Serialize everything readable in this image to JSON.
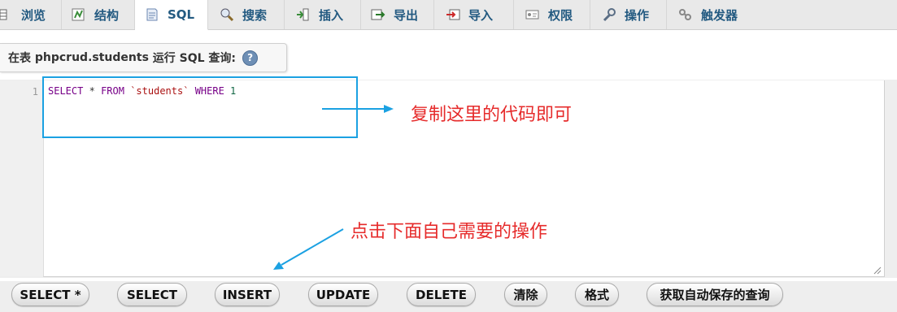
{
  "tabs": [
    {
      "label": "浏览",
      "icon": "browse-icon"
    },
    {
      "label": "结构",
      "icon": "structure-icon"
    },
    {
      "label": "SQL",
      "icon": "sql-icon",
      "active": true
    },
    {
      "label": "搜索",
      "icon": "search-icon"
    },
    {
      "label": "插入",
      "icon": "insert-icon"
    },
    {
      "label": "导出",
      "icon": "export-icon"
    },
    {
      "label": "导入",
      "icon": "import-icon"
    },
    {
      "label": "权限",
      "icon": "privileges-icon"
    },
    {
      "label": "操作",
      "icon": "operations-icon"
    },
    {
      "label": "触发器",
      "icon": "triggers-icon"
    }
  ],
  "query_panel": {
    "title_prefix": "在表 ",
    "table": "phpcrud.students",
    "title_suffix": " 运行 SQL 查询:"
  },
  "editor": {
    "line_number": "1",
    "tokens": {
      "select": "SELECT",
      "star": "*",
      "from": "FROM",
      "table": "`students`",
      "where": "WHERE",
      "value": "1"
    }
  },
  "annotations": {
    "copy_hint": "复制这里的代码即可",
    "click_hint": "点击下面自己需要的操作"
  },
  "buttons": [
    {
      "label": "SELECT *"
    },
    {
      "label": "SELECT"
    },
    {
      "label": "INSERT"
    },
    {
      "label": "UPDATE"
    },
    {
      "label": "DELETE"
    },
    {
      "label": "清除"
    },
    {
      "label": "格式"
    },
    {
      "label": "获取自动保存的查询"
    }
  ],
  "colors": {
    "link": "#235a81",
    "annotation": "#e62b2b",
    "highlight": "#1ba1e2"
  }
}
